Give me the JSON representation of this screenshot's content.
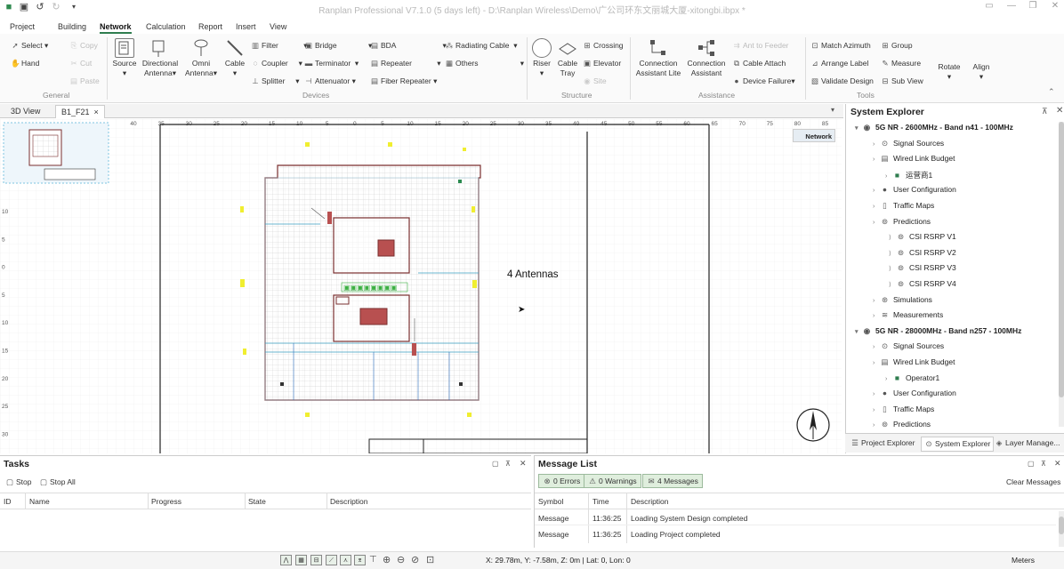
{
  "app": {
    "title": "Ranplan Professional V7.1.0 (5 days left) - D:\\Ranplan Wireless\\Demo\\广公司环东文丽城大厦-xitongbi.ibpx *"
  },
  "menu": [
    "Project",
    "Building",
    "Network",
    "Calculation",
    "Report",
    "Insert",
    "View"
  ],
  "menu_active": "Network",
  "ribbon": {
    "general": {
      "select": "Select",
      "hand": "Hand",
      "copy": "Copy",
      "cut": "Cut",
      "paste": "Paste",
      "group": "General"
    },
    "devices": {
      "source": "Source",
      "directional": "Directional",
      "antenna": "Antenna",
      "omni": "Omni",
      "cable": "Cable",
      "filter": "Filter",
      "coupler": "Coupler",
      "splitter": "Splitter",
      "bridge": "Bridge",
      "terminator": "Terminator",
      "attenuator": "Attenuator",
      "bda": "BDA",
      "repeater": "Repeater",
      "fiber_repeater": "Fiber Repeater",
      "radiating_cable": "Radiating Cable",
      "others": "Others",
      "group": "Devices"
    },
    "structure": {
      "riser": "Riser",
      "cable": "Cable",
      "tray": "Tray",
      "crossing": "Crossing",
      "elevator": "Elevator",
      "site": "Site",
      "group": "Structure"
    },
    "assistance": {
      "conn": "Connection",
      "assistant_lite": "Assistant Lite",
      "conn2": "Connection",
      "assistant": "Assistant",
      "ant_to_feeder": "Ant to Feeder",
      "cable_attach": "Cable Attach",
      "device_failure": "Device Failure",
      "group": "Assistance"
    },
    "tools": {
      "match_azimuth": "Match Azimuth",
      "group_btn": "Group",
      "arrange_label": "Arrange Label",
      "measure": "Measure",
      "validate_design": "Validate Design",
      "sub_view": "Sub View",
      "rotate": "Rotate",
      "align": "Align",
      "group": "Tools"
    }
  },
  "doc_tabs": [
    "3D View",
    "B1_F21"
  ],
  "doc_tab_close": "×",
  "canvas": {
    "annotation": "4 Antennas",
    "network_badge": "Network",
    "ruler_top": [
      "40",
      "35",
      "30",
      "25",
      "20",
      "15",
      "10",
      "5",
      "0",
      "5",
      "10",
      "15",
      "20",
      "25",
      "30",
      "35",
      "40",
      "45",
      "50",
      "55",
      "60",
      "65",
      "70",
      "75",
      "80",
      "85"
    ],
    "ruler_left": [
      "10",
      "5",
      "0",
      "5",
      "10",
      "15",
      "20",
      "25",
      "30"
    ]
  },
  "explorer": {
    "title": "System Explorer",
    "items": [
      {
        "label": "5G NR - 2600MHz - Band n41 - 100MHz",
        "level": 0,
        "bold": true,
        "icon": "signal-icon"
      },
      {
        "label": "Signal Sources",
        "level": 1,
        "icon": "antenna-icon"
      },
      {
        "label": "Wired Link Budget",
        "level": 1,
        "icon": "budget-icon"
      },
      {
        "label": "运营商1",
        "level": 2,
        "icon": "operator-icon"
      },
      {
        "label": "User Configuration",
        "level": 1,
        "icon": "user-icon"
      },
      {
        "label": "Traffic Maps",
        "level": 1,
        "icon": "traffic-icon"
      },
      {
        "label": "Predictions",
        "level": 1,
        "icon": "prediction-icon"
      },
      {
        "label": "CSI RSRP V1",
        "level": 3,
        "icon": "prediction-icon"
      },
      {
        "label": "CSI RSRP V2",
        "level": 3,
        "icon": "prediction-icon"
      },
      {
        "label": "CSI RSRP V3",
        "level": 3,
        "icon": "prediction-icon"
      },
      {
        "label": "CSI RSRP V4",
        "level": 3,
        "icon": "prediction-icon"
      },
      {
        "label": "Simulations",
        "level": 1,
        "icon": "simulation-icon"
      },
      {
        "label": "Measurements",
        "level": 1,
        "icon": "wifi-icon"
      },
      {
        "label": "5G NR - 28000MHz - Band n257 - 100MHz",
        "level": 0,
        "bold": true,
        "icon": "signal-icon"
      },
      {
        "label": "Signal Sources",
        "level": 1,
        "icon": "antenna-icon"
      },
      {
        "label": "Wired Link Budget",
        "level": 1,
        "icon": "budget-icon"
      },
      {
        "label": "Operator1",
        "level": 2,
        "icon": "operator-icon"
      },
      {
        "label": "User Configuration",
        "level": 1,
        "icon": "user-icon"
      },
      {
        "label": "Traffic Maps",
        "level": 1,
        "icon": "traffic-icon"
      },
      {
        "label": "Predictions",
        "level": 1,
        "icon": "prediction-icon"
      }
    ],
    "bottom_tabs": [
      "Project Explorer",
      "System Explorer",
      "Layer Manage..."
    ]
  },
  "tasks": {
    "title": "Tasks",
    "stop": "Stop",
    "stop_all": "Stop All",
    "columns": [
      "ID",
      "Name",
      "Progress",
      "State",
      "Description"
    ]
  },
  "messages": {
    "title": "Message List",
    "errors": "0 Errors",
    "warnings": "0 Warnings",
    "count": "4 Messages",
    "clear": "Clear Messages",
    "columns": [
      "Symbol",
      "Time",
      "Description"
    ],
    "rows": [
      {
        "symbol": "Message",
        "time": "11:36:25",
        "desc": "Loading System Design completed"
      },
      {
        "symbol": "Message",
        "time": "11:36:25",
        "desc": "Loading Project completed"
      }
    ]
  },
  "status": {
    "coords": "X: 29.78m, Y: -7.58m, Z: 0m | Lat: 0, Lon: 0",
    "units": "Meters"
  },
  "colors": {
    "accent": "#2f7d4f",
    "badge": "#dfeedd"
  }
}
